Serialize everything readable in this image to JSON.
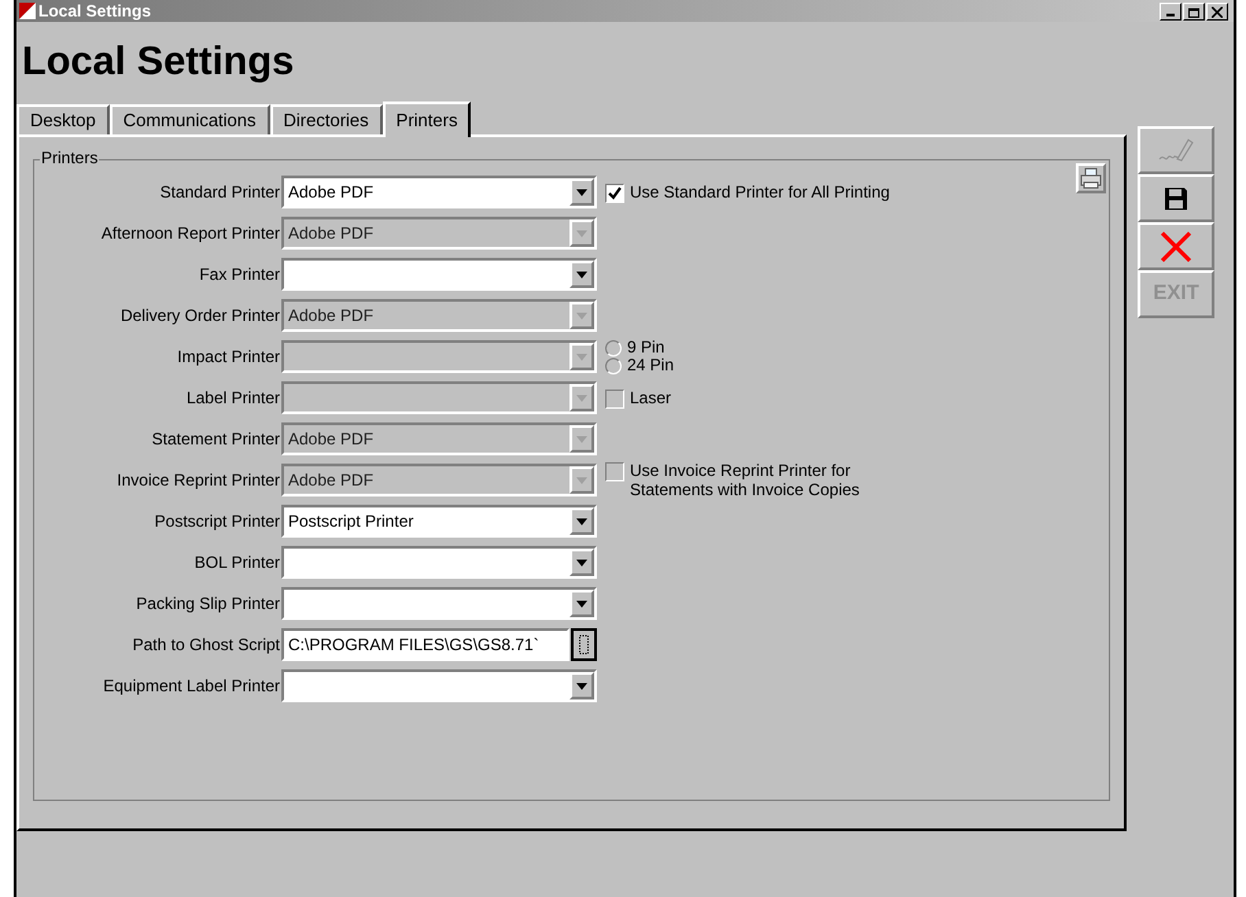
{
  "window": {
    "title": "Local Settings"
  },
  "heading": "Local Settings",
  "tabs": [
    {
      "label": "Desktop",
      "selected": false
    },
    {
      "label": "Communications",
      "selected": false
    },
    {
      "label": "Directories",
      "selected": false
    },
    {
      "label": "Printers",
      "selected": true
    }
  ],
  "group": {
    "title": "Printers",
    "rows": [
      {
        "kind": "combo",
        "label": "Standard Printer",
        "value": "Adobe PDF",
        "disabled": false,
        "extras": [
          {
            "kind": "checkbox",
            "label": "Use Standard Printer for All Printing",
            "checked": true
          }
        ]
      },
      {
        "kind": "combo",
        "label": "Afternoon Report Printer",
        "value": "Adobe PDF",
        "disabled": true
      },
      {
        "kind": "combo",
        "label": "Fax Printer",
        "disabled": false
      },
      {
        "kind": "combo",
        "label": "Delivery Order Printer",
        "value": "Adobe PDF",
        "disabled": true
      },
      {
        "kind": "combo",
        "label": "Impact Printer",
        "disabled": true,
        "extras": [
          {
            "kind": "radio",
            "label": "9 Pin",
            "selected": false
          },
          {
            "kind": "radio",
            "label": "24 Pin",
            "selected": false
          }
        ]
      },
      {
        "kind": "combo",
        "label": "Label Printer",
        "disabled": true,
        "extras": [
          {
            "kind": "checkbox",
            "label": "Laser",
            "checked": false
          }
        ]
      },
      {
        "kind": "combo",
        "label": "Statement Printer",
        "value": "Adobe PDF",
        "disabled": true
      },
      {
        "kind": "combo",
        "label": "Invoice Reprint Printer",
        "value": "Adobe PDF",
        "disabled": true,
        "extras": [
          {
            "kind": "checkbox",
            "label": "Use Invoice Reprint Printer for Statements with Invoice Copies",
            "checked": false
          }
        ]
      },
      {
        "kind": "combo",
        "label": "Postscript Printer",
        "value": "Postscript Printer",
        "disabled": false
      },
      {
        "kind": "combo",
        "label": "BOL Printer",
        "disabled": false
      },
      {
        "kind": "combo",
        "label": "Packing Slip Printer",
        "disabled": false
      },
      {
        "kind": "path",
        "label": "Path to Ghost Script",
        "value": "C:\\PROGRAM FILES\\GS\\GS8.71`",
        "disabled": false
      },
      {
        "kind": "combo",
        "label": "Equipment Label Printer",
        "disabled": false
      }
    ]
  },
  "toolbar": [
    {
      "kind": "sign",
      "disabled": true
    },
    {
      "kind": "save",
      "disabled": false
    },
    {
      "kind": "cancel",
      "disabled": false
    },
    {
      "kind": "exit",
      "label": "EXIT",
      "disabled": true
    }
  ]
}
